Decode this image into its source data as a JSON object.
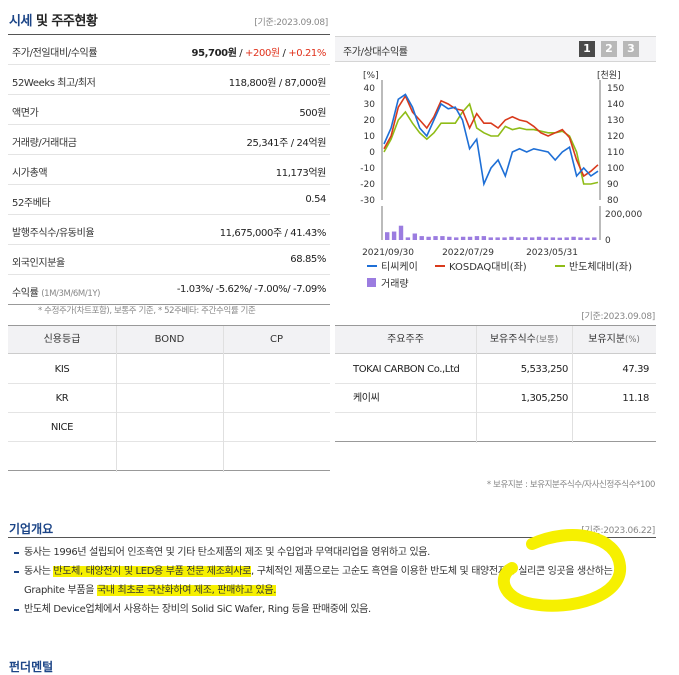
{
  "market": {
    "title_main": "시세",
    "title_rest": " 및 주주현황",
    "as_of": "[기준:2023.09.08]",
    "rows": [
      {
        "label": "주가/전일대비/수익률",
        "price": "95,700원",
        "sep1": " / ",
        "change": "+200원",
        "sep2": " / ",
        "rate": "+0.21%"
      },
      {
        "label": "52Weeks 최고/최저",
        "value": "118,800원 / 87,000원"
      },
      {
        "label": "액면가",
        "value": "500원"
      },
      {
        "label": "거래량/거래대금",
        "value": "25,341주 / 24억원"
      },
      {
        "label": "시가총액",
        "value": "11,173억원"
      },
      {
        "label": "52주베타",
        "value": "0.54"
      },
      {
        "label": "발행주식수/유동비율",
        "value": "11,675,000주 / 41.43%"
      },
      {
        "label": "외국인지분율",
        "value": "68.85%"
      },
      {
        "label": "수익률",
        "label_sub": "(1M/3M/6M/1Y)",
        "value": "-1.03%/ -5.62%/ -7.00%/ -7.09%"
      }
    ],
    "footnote": "* 수정주가(차트포함), 보통주 기준, * 52주베타: 주간수익률 기준"
  },
  "chart_panel": {
    "title": "주가/상대수익률",
    "buttons": [
      "1",
      "2",
      "3"
    ],
    "colors": {
      "active": "#4a4a4a",
      "inactive": "#b8b8b8"
    }
  },
  "chart_data": {
    "type": "line",
    "left_unit": "[%]",
    "right_unit": "[천원]",
    "left_ticks": [
      "40",
      "30",
      "20",
      "10",
      "0",
      "-10",
      "-20",
      "-30"
    ],
    "right_ticks": [
      "150",
      "140",
      "130",
      "120",
      "110",
      "100",
      "90",
      "80"
    ],
    "volume_ticks": [
      "200,000",
      "0"
    ],
    "x_labels": [
      "2021/09/30",
      "2022/07/29",
      "2023/05/31"
    ],
    "ylim_left": [
      -30,
      40
    ],
    "ylim_right": [
      80,
      150
    ],
    "series": [
      {
        "name": "티씨케이",
        "color": "#1e6fd6",
        "values": [
          5,
          15,
          33,
          36,
          28,
          15,
          10,
          20,
          30,
          27,
          28,
          20,
          2,
          8,
          -20,
          -10,
          -5,
          -15,
          0,
          2,
          0,
          2,
          1,
          0,
          -5,
          0,
          3,
          -15,
          -10,
          -15,
          -12
        ]
      },
      {
        "name": "KOSDAQ대비(좌)",
        "color": "#d93a1c",
        "values": [
          2,
          10,
          28,
          35,
          25,
          20,
          15,
          22,
          32,
          30,
          27,
          26,
          15,
          24,
          18,
          18,
          15,
          20,
          22,
          20,
          19,
          16,
          12,
          10,
          12,
          14,
          9,
          -5,
          -15,
          -12,
          -8
        ]
      },
      {
        "name": "반도체대비(좌)",
        "color": "#8fbc17",
        "values": [
          0,
          8,
          20,
          25,
          18,
          12,
          8,
          12,
          18,
          18,
          18,
          25,
          30,
          15,
          12,
          10,
          10,
          16,
          14,
          15,
          14,
          14,
          13,
          12,
          12,
          13,
          10,
          0,
          -20,
          -20,
          -19
        ]
      }
    ],
    "volume": {
      "name": "거래량",
      "color": "#9b7ce0",
      "values": [
        60000,
        65000,
        110000,
        20000,
        50000,
        30000,
        25000,
        30000,
        30000,
        25000,
        20000,
        25000,
        25000,
        30000,
        30000,
        20000,
        20000,
        20000,
        25000,
        20000,
        22000,
        20000,
        25000,
        20000,
        20000,
        18000,
        20000,
        25000,
        20000,
        18000,
        20000
      ]
    },
    "ylim_volume": [
      0,
      200000
    ]
  },
  "rating": {
    "as_of": "[기준:2023.09.08]",
    "headers": [
      "신용등급",
      "BOND",
      "CP"
    ],
    "rows": [
      "KIS",
      "KR",
      "NICE"
    ]
  },
  "holders": {
    "headers": [
      "주요주주",
      "보유주식수",
      "(보통)",
      "보유지분",
      "(%)"
    ],
    "rows": [
      {
        "name": "TOKAI CARBON Co.,Ltd",
        "shares": "5,533,250",
        "pct": "47.39"
      },
      {
        "name": "케이씨",
        "shares": "1,305,250",
        "pct": "11.18"
      }
    ],
    "footnote": "* 보유지분 : 보유지분주식수/자사신정주식수*100"
  },
  "overview": {
    "title": "기업개요",
    "as_of": "[기준:2023.06.22]",
    "items": [
      [
        {
          "t": "동사는 1996년 설립되어 인조흑연 및 기타 탄소제품의 제조 및 수입업과 무역대리업을 영위하고 있음.",
          "h": false
        }
      ],
      [
        {
          "t": "동사는 ",
          "h": false
        },
        {
          "t": "반도체, 태양전지 및 LED용 부품 전문 제조회사로",
          "h": true
        },
        {
          "t": ", 구체적인 제품으로는 고순도 흑연을 이용한 반도체 및 태양전지용 실리콘 잉곳을 생산하는 Graphite 부품을 ",
          "h": false
        },
        {
          "t": "국내 최초로 국산화하여 제조, 판매하고 있음.",
          "h": true
        }
      ],
      [
        {
          "t": "반도체 Device업체에서 사용하는 장비의 Solid SiC Wafer, Ring 등을 판매중에 있음.",
          "h": false
        }
      ]
    ],
    "next_title": "펀더멘털"
  }
}
